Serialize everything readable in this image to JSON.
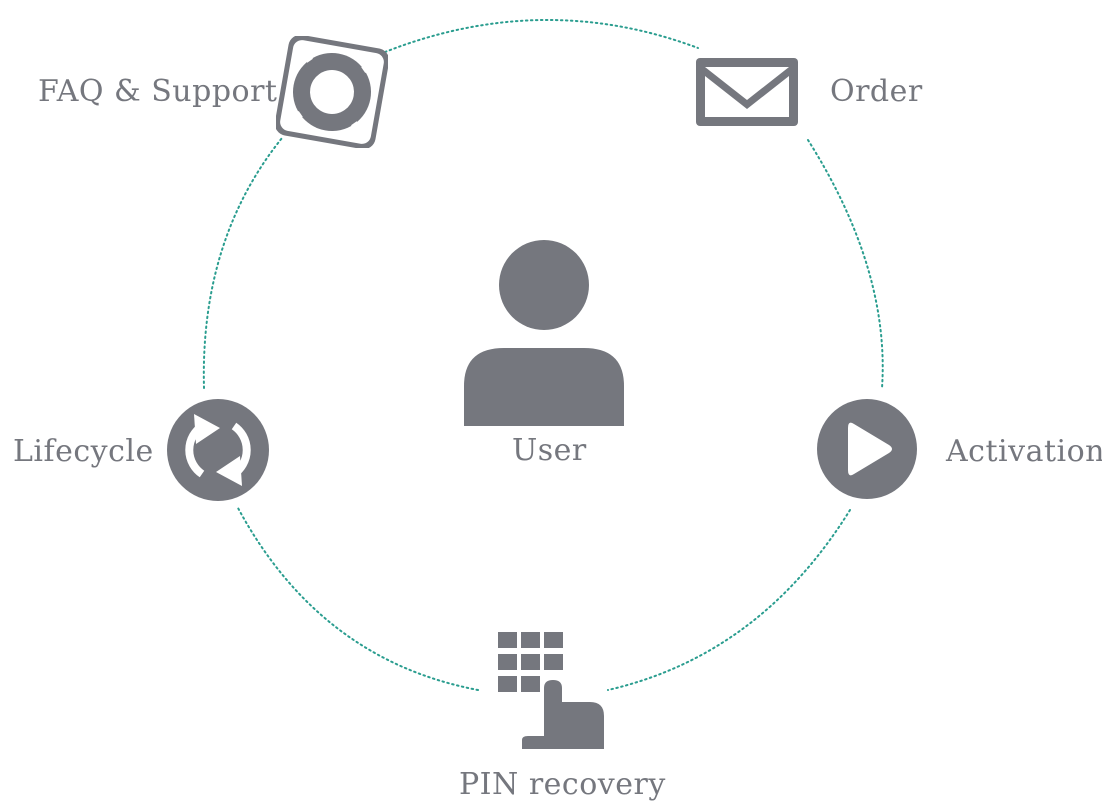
{
  "colors": {
    "icon": "#75777e",
    "ring": "#2a9d8f",
    "text": "#75777e",
    "background": "#ffffff"
  },
  "center": {
    "label": "User",
    "icon": "user-icon"
  },
  "nodes": [
    {
      "id": "faq",
      "label": "FAQ & Support",
      "icon": "lifebuoy-icon"
    },
    {
      "id": "order",
      "label": "Order",
      "icon": "envelope-icon"
    },
    {
      "id": "activation",
      "label": "Activation",
      "icon": "play-icon"
    },
    {
      "id": "pin",
      "label": "PIN recovery",
      "icon": "keypad-icon"
    },
    {
      "id": "lifecycle",
      "label": "Lifecycle",
      "icon": "refresh-icon"
    }
  ]
}
